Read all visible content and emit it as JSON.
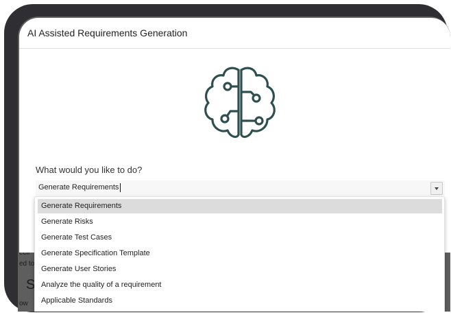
{
  "modal": {
    "title": "AI Assisted Requirements Generation",
    "prompt": "What would you like to do?",
    "select": {
      "value": "Generate Requirements",
      "options": [
        "Generate Requirements",
        "Generate Risks",
        "Generate Test Cases",
        "Generate Specification Template",
        "Generate User Stories",
        "Analyze the quality of a requirement",
        "Applicable Standards"
      ]
    },
    "icon": "brain-circuit-icon",
    "colors": {
      "icon_stroke": "#2f4f4f",
      "selected_option_bg": "#dcdcdc"
    }
  },
  "background": {
    "fragment_1": "ecif",
    "fragment_2": "ed to",
    "fragment_3": "S",
    "fragment_4": "ow"
  }
}
